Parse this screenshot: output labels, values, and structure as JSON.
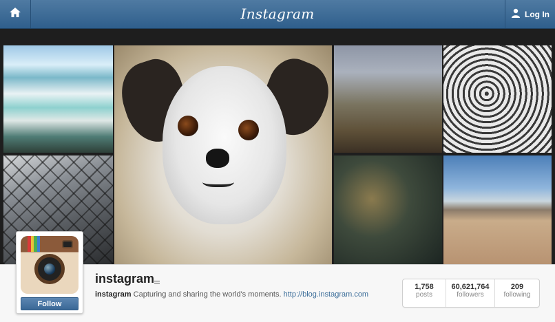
{
  "header": {
    "brand": "Instagram",
    "home_icon": "home-icon",
    "login_icon": "user-icon",
    "login_label": "Log In",
    "colors": {
      "bar": "#3b6a95",
      "text": "#ffffff"
    }
  },
  "photos": [
    {
      "subject": "travertine terraces landscape"
    },
    {
      "subject": "city street through chain-link fence"
    },
    {
      "subject": "shih tzu puppy close-up"
    },
    {
      "subject": "couple in front of barn"
    },
    {
      "subject": "street art mural painter"
    },
    {
      "subject": "dragonfly on branch"
    },
    {
      "subject": "rider on horse in desert"
    }
  ],
  "profile": {
    "username": "instagram",
    "bio_name": "instagram",
    "bio_text": "Capturing and sharing the world's moments.",
    "bio_link": "http://blog.instagram.com",
    "follow_label": "Follow",
    "stats": [
      {
        "value": "1,758",
        "label": "posts"
      },
      {
        "value": "60,621,764",
        "label": "followers"
      },
      {
        "value": "209",
        "label": "following"
      }
    ]
  }
}
